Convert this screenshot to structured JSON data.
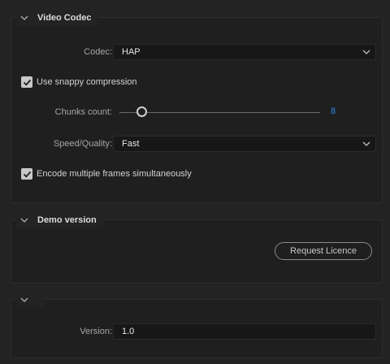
{
  "video_codec": {
    "title": "Video Codec",
    "codec_label": "Codec:",
    "codec_value": "HAP",
    "snappy_label": "Use snappy compression",
    "snappy_checked": true,
    "chunks_label": "Chunks count:",
    "chunks_value": "8",
    "speed_label": "Speed/Quality:",
    "speed_value": "Fast",
    "multiframe_label": "Encode multiple frames simultaneously",
    "multiframe_checked": true
  },
  "demo": {
    "title": "Demo version",
    "request_button": "Request Licence"
  },
  "about": {
    "title": "",
    "version_label": "Version:",
    "version_value": "1.0"
  },
  "colors": {
    "accent": "#2d8ceb",
    "background": "#232323"
  }
}
